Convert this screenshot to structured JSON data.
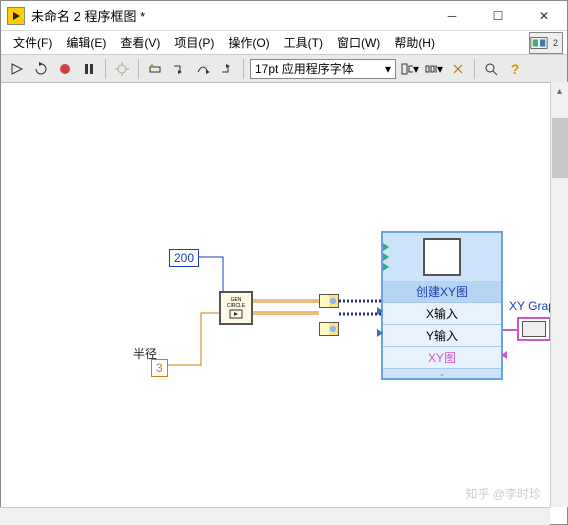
{
  "window": {
    "title": "未命名 2 程序框图 *"
  },
  "menu": {
    "file": "文件(F)",
    "edit": "编辑(E)",
    "view": "查看(V)",
    "project": "项目(P)",
    "operate": "操作(O)",
    "tools": "工具(T)",
    "window": "窗口(W)",
    "help": "帮助(H)",
    "ctx_badge": "2"
  },
  "toolbar": {
    "font_label": "17pt 应用程序字体"
  },
  "diagram": {
    "const_200": "200",
    "radius_label": "半径",
    "radius_value": "3",
    "subvi_line1": "GEN",
    "subvi_line2": "CIRCLE",
    "express_title": "创建XY图",
    "express_x": "X输入",
    "express_y": "Y输入",
    "express_out": "XY图",
    "indicator_label": "XY Graph"
  },
  "watermark": "知乎 @李时珍"
}
